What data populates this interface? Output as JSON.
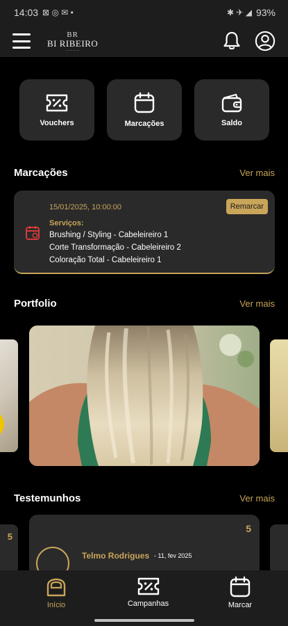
{
  "status_bar": {
    "time": "14:03",
    "battery": "93%"
  },
  "header": {
    "logo_mark": "BR",
    "logo_text": "BI RIBEIRO"
  },
  "quick_actions": [
    {
      "label": "Vouchers",
      "icon": "voucher-icon"
    },
    {
      "label": "Marcações",
      "icon": "calendar-icon"
    },
    {
      "label": "Saldo",
      "icon": "wallet-icon"
    }
  ],
  "bookings": {
    "title": "Marcações",
    "see_more": "Ver mais",
    "card": {
      "datetime": "15/01/2025, 10:00:00",
      "reschedule_label": "Remarcar",
      "services_label": "Serviços:",
      "services": [
        "Brushing / Styling - Cabeleireiro 1",
        "Corte Transformação - Cabeleireiro 2",
        "Coloração Total - Cabeleireiro 1"
      ]
    }
  },
  "portfolio": {
    "title": "Portfolio",
    "see_more": "Ver mais"
  },
  "testimonials": {
    "title": "Testemunhos",
    "see_more": "Ver mais",
    "side_rating": "5",
    "card": {
      "rating": "5",
      "name": "Telmo Rodrigues",
      "date": "-  11, fev 2025"
    }
  },
  "bottom_nav": [
    {
      "label": "Início",
      "icon": "home-icon",
      "active": true
    },
    {
      "label": "Campanhas",
      "icon": "campaign-icon",
      "active": false
    },
    {
      "label": "Marcar",
      "icon": "calendar-icon",
      "active": false
    }
  ],
  "colors": {
    "accent": "#c9a55a",
    "card": "#2a2a2a",
    "bar": "#1d1d1d",
    "background": "#000000"
  }
}
